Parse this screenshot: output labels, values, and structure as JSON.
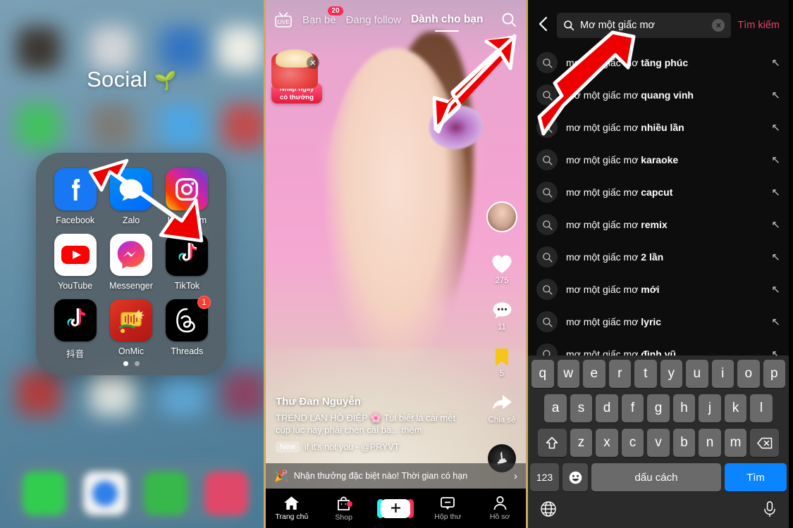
{
  "theme": {
    "accent_pink": "#fe2c55",
    "search_link": "#e8436a",
    "keyboard_go": "#0a84ff",
    "annotation_arrow": "#ee0000"
  },
  "home_screen": {
    "folder_title": "Social",
    "folder_title_emoji": "🌱",
    "apps": [
      {
        "label": "Facebook",
        "icon": "facebook-icon"
      },
      {
        "label": "Zalo",
        "icon": "zalo-icon"
      },
      {
        "label": "Instagram",
        "icon": "instagram-icon"
      },
      {
        "label": "YouTube",
        "icon": "youtube-icon"
      },
      {
        "label": "Messenger",
        "icon": "messenger-icon"
      },
      {
        "label": "TikTok",
        "icon": "tiktok-icon"
      },
      {
        "label": "抖音",
        "icon": "douyin-icon"
      },
      {
        "label": "OnMic",
        "icon": "onmic-icon"
      },
      {
        "label": "Threads",
        "icon": "threads-icon",
        "badge": "1"
      }
    ],
    "page_dots": 2,
    "active_dot": 0
  },
  "tiktok_feed": {
    "live_label": "LIVE",
    "tabs": [
      {
        "label": "Bạn bè",
        "badge": "20",
        "active": false
      },
      {
        "label": "Đang follow",
        "active": false
      },
      {
        "label": "Dành cho bạn",
        "active": true
      }
    ],
    "search_icon": "search-icon",
    "gift_promo": {
      "line1": "Nhấp ngay",
      "line2": "có thưởng",
      "close": "✕"
    },
    "actions": {
      "like_count": "275",
      "comment_count": "11",
      "bookmark_count": "5",
      "share_label": "Chia sẻ"
    },
    "caption": {
      "username": "Thư Đan Nguyễn",
      "text": "TREND LAN HỒ ĐIỆP 🌸 Tui biết là cái mết cúp lúc này phải chèn cái bà... thêm",
      "new_tag": "New",
      "song": "if it's not you - @PRYVT"
    },
    "promo_banner": {
      "emoji": "🎉",
      "text": "Nhận thưởng đặc biệt nào! Thời gian có hạn",
      "chevron": "›"
    },
    "navbar": [
      {
        "label": "Trang chủ",
        "icon": "home-icon",
        "active": true
      },
      {
        "label": "Shop",
        "icon": "shop-bag-icon",
        "dot": true
      },
      {
        "label": "",
        "icon": "create-plus-icon"
      },
      {
        "label": "Hộp thư",
        "icon": "inbox-message-icon"
      },
      {
        "label": "Hồ sơ",
        "icon": "profile-person-icon"
      }
    ]
  },
  "tiktok_search": {
    "back_icon": "chevron-left-icon",
    "query_value": "Mơ một giấc mơ",
    "query_placeholder": "Tìm kiếm",
    "clear_icon": "clear-circle-icon",
    "search_button": "Tìm kiếm",
    "suggestions": [
      {
        "prefix": "mơ một giấc mơ ",
        "bold": "tăng phúc"
      },
      {
        "prefix": "mơ một giấc mơ ",
        "bold": "quang vinh"
      },
      {
        "prefix": "mơ một giấc mơ ",
        "bold": "nhiều lần"
      },
      {
        "prefix": "mơ một giấc mơ ",
        "bold": "karaoke"
      },
      {
        "prefix": "mơ một giấc mơ ",
        "bold": "capcut"
      },
      {
        "prefix": "mơ một giấc mơ ",
        "bold": "remix"
      },
      {
        "prefix": "mơ một giấc mơ ",
        "bold": "2 lần"
      },
      {
        "prefix": "mơ một giấc mơ ",
        "bold": "mới"
      },
      {
        "prefix": "mơ một giấc mơ ",
        "bold": "lyric"
      },
      {
        "prefix": "mơ một giấc mơ ",
        "bold": "đình vũ"
      }
    ],
    "keyboard": {
      "row1": [
        "q",
        "w",
        "e",
        "r",
        "t",
        "y",
        "u",
        "i",
        "o",
        "p"
      ],
      "row2": [
        "a",
        "s",
        "d",
        "f",
        "g",
        "h",
        "j",
        "k",
        "l"
      ],
      "row3": [
        "z",
        "x",
        "c",
        "v",
        "b",
        "n",
        "m"
      ],
      "shift": "⇧",
      "backspace": "⌫",
      "numbers": "123",
      "emoji": "☺",
      "space": "dấu cách",
      "go": "Tìm",
      "globe": "🌐",
      "mic": "🎤"
    }
  }
}
